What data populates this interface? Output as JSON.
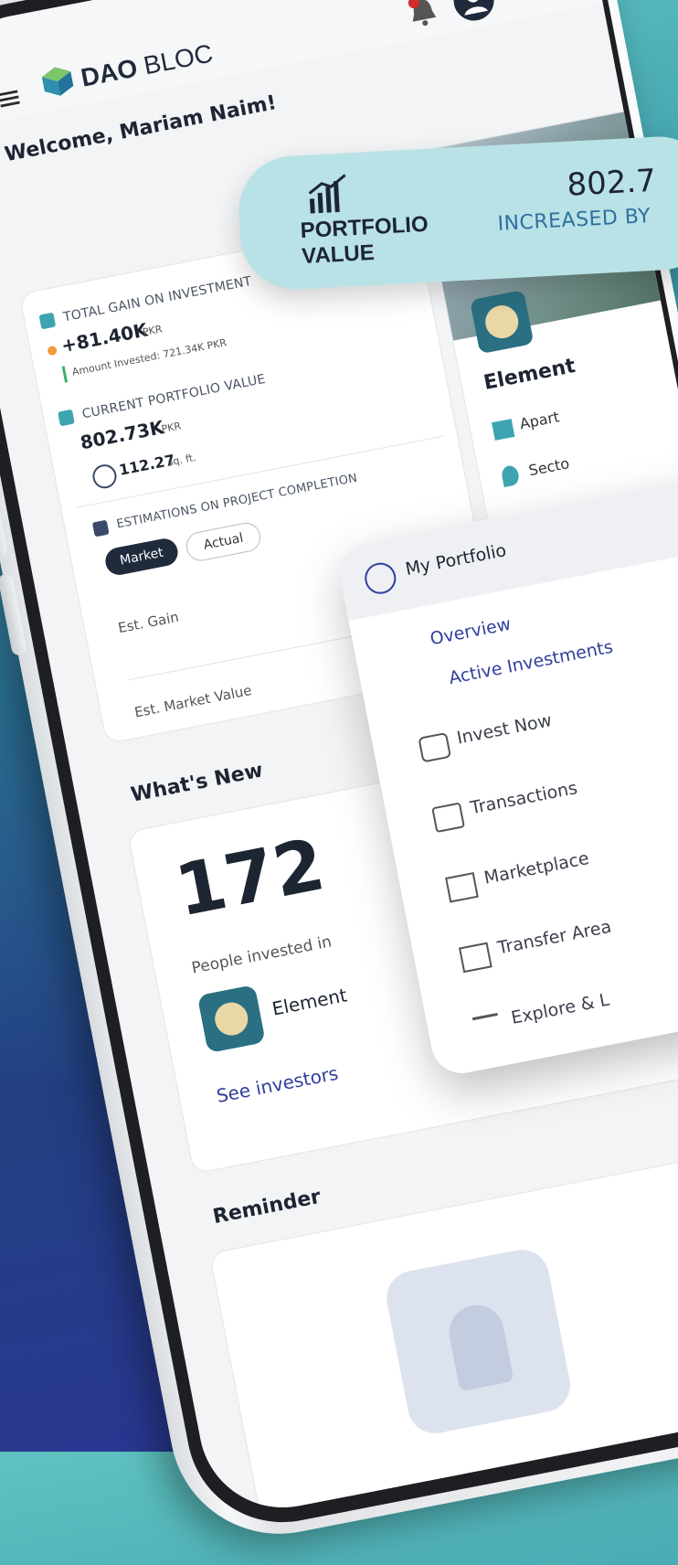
{
  "app": {
    "brand_bold": "DAO",
    "brand_light": "BLOC"
  },
  "header": {
    "welcome": "Welcome, Mariam Naim!"
  },
  "portfolio_popup": {
    "title_line1": "PORTFOLIO",
    "title_line2": "VALUE",
    "value": "802.7",
    "subtitle": "INCREASED BY"
  },
  "stats": {
    "total_gain_label": "TOTAL GAIN ON INVESTMENT",
    "total_gain_value": "+81.40K",
    "total_gain_unit": "PKR",
    "amount_invested": "Amount Invested: 721.34K PKR",
    "current_value_label": "CURRENT PORTFOLIO VALUE",
    "current_value": "802.73K",
    "current_value_unit": "PKR",
    "area_value": "112.27",
    "area_unit": "sq. ft.",
    "estimations_label": "ESTIMATIONS ON PROJECT COMPLETION",
    "toggle_market": "Market",
    "toggle_actual": "Actual",
    "est_gain": "Est. Gain",
    "est_market_value": "Est. Market Value"
  },
  "project_card": {
    "name": "Element",
    "type": "Apart",
    "location": "Secto"
  },
  "whats_new": {
    "title": "What's New",
    "count": "172",
    "caption": "People invested in",
    "project": "Element",
    "link": "See investors"
  },
  "reminder": {
    "title": "Reminder"
  },
  "menu": {
    "header": "My Portfolio",
    "items": [
      {
        "label": "Overview",
        "icon": "none"
      },
      {
        "label": "Active Investments",
        "icon": "none"
      },
      {
        "label": "Invest Now",
        "icon": "money-hand-icon"
      },
      {
        "label": "Transactions",
        "icon": "card-icon"
      },
      {
        "label": "Marketplace",
        "icon": "building-icon"
      },
      {
        "label": "Transfer Area",
        "icon": "building-icon"
      },
      {
        "label": "Explore & L",
        "icon": "graduation-cap-icon"
      }
    ]
  },
  "colors": {
    "accent": "#3fa4b1",
    "brand_blue": "#2f3f9c",
    "popup": "#b9e2e6"
  }
}
